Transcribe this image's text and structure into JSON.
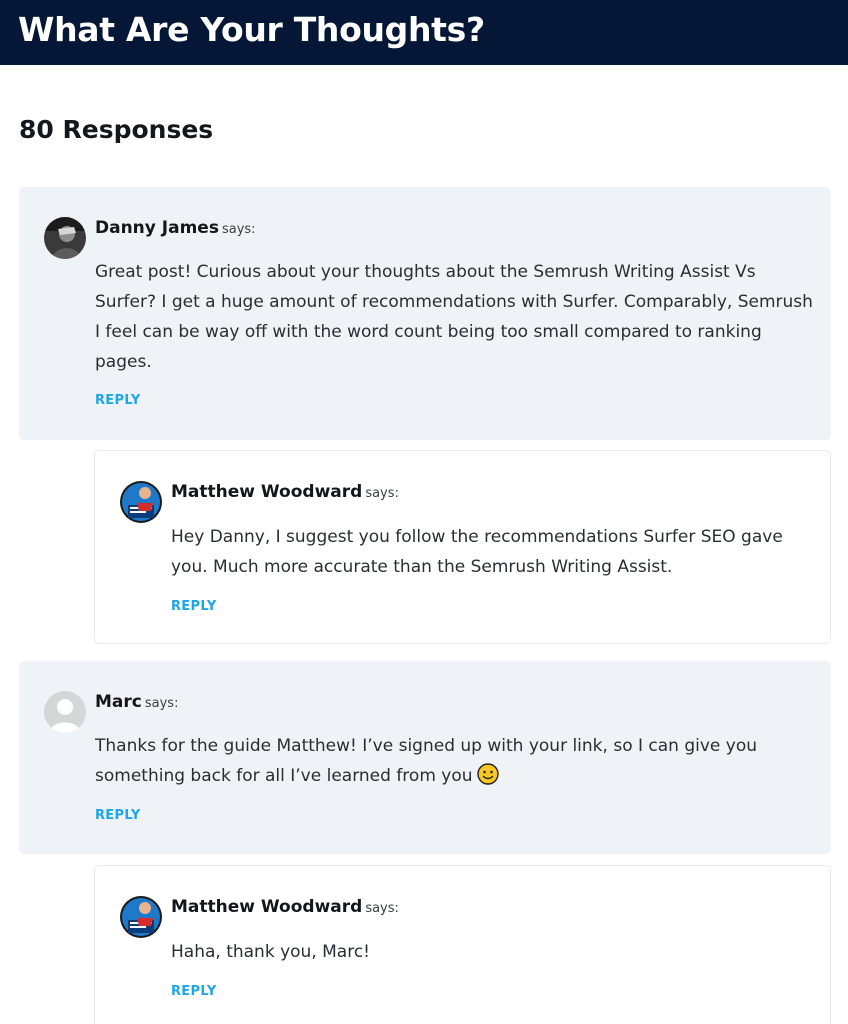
{
  "header": {
    "title": "What Are Your Thoughts?"
  },
  "comments_section": {
    "count_label": "80 Responses",
    "says_label": "says:",
    "reply_label": "REPLY",
    "comments": [
      {
        "author": "Danny James",
        "avatar_icon": "user-photo-dark",
        "text": "Great post! Curious about your thoughts about the Semrush Writing Assist Vs Surfer? I get a huge amount of recommendations with Surfer. Comparably, Semrush I feel can be way off with the word count being too small compared to ranking pages."
      },
      {
        "author": "Matthew Woodward",
        "avatar_icon": "user-photo-blue",
        "text": "Hey Danny, I suggest you follow the recommendations Surfer SEO gave you. Much more accurate than the Semrush Writing Assist."
      },
      {
        "author": "Marc",
        "avatar_icon": "default-avatar",
        "text": "Thanks for the guide Matthew! I’ve signed up with your link, so I can give you something back for all I’ve learned from you",
        "emoji": "slightly-smiling-face"
      },
      {
        "author": "Matthew Woodward",
        "avatar_icon": "user-photo-blue",
        "text": "Haha, thank you, Marc!"
      }
    ]
  },
  "colors": {
    "banner_bg": "#061636",
    "comment_bg": "#eff2f7",
    "reply_link": "#1fa6e8"
  }
}
